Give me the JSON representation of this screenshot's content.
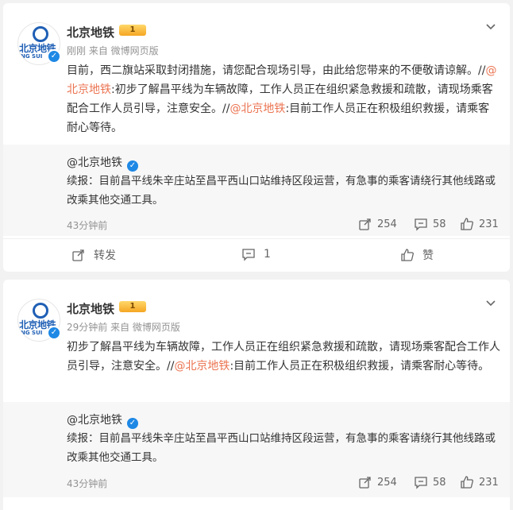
{
  "posts": [
    {
      "user": {
        "name": "北京地铁",
        "avatar_text": "北京地铁",
        "avatar_sub": "NG SUI",
        "level": "1"
      },
      "meta": "刚刚  来自 微博网页版",
      "text_part1": "目前，西二旗站采取封闭措施，请您配合现场引导，由此给您带来的不便敬请谅解。//",
      "mention1": "@北京地铁",
      "text_part2": ":初步了解昌平线为车辆故障，工作人员正在组织紧急救援和疏散，请现场乘客配合工作人员引导，注意安全。//",
      "mention2": "@北京地铁",
      "text_part3": ":目前工作人员正在积极组织救援，请乘客耐心等待。",
      "repost": {
        "user": "@北京地铁",
        "text": "续报：目前昌平线朱辛庄站至昌平西山口站维持区段运营，有急事的乘客请绕行其他线路或改乘其他交通工具。",
        "time": "43分钟前",
        "shares": "254",
        "comments": "58",
        "likes": "231"
      },
      "toolbar": {
        "forward": "转发",
        "comment": "1",
        "like": "赞"
      }
    },
    {
      "user": {
        "name": "北京地铁",
        "avatar_text": "北京地铁",
        "avatar_sub": "NG SUI",
        "level": "1"
      },
      "meta": "29分钟前  来自 微博网页版",
      "text_part1": "初步了解昌平线为车辆故障，工作人员正在组织紧急救援和疏散，请现场乘客配合工作人员引导，注意安全。//",
      "mention1": "@北京地铁",
      "text_part2": ":目前工作人员正在积极组织救援，请乘客耐心等待。",
      "repost": {
        "user": "@北京地铁",
        "text": "续报：目前昌平线朱辛庄站至昌平西山口站维持区段运营，有急事的乘客请绕行其他线路或改乘其他交通工具。",
        "time": "43分钟前",
        "shares": "254",
        "comments": "58",
        "likes": "231"
      }
    }
  ],
  "colors": {
    "mention": "#eb7350",
    "verified": "#1e88e5",
    "repost_bg": "#f7f7f7"
  }
}
